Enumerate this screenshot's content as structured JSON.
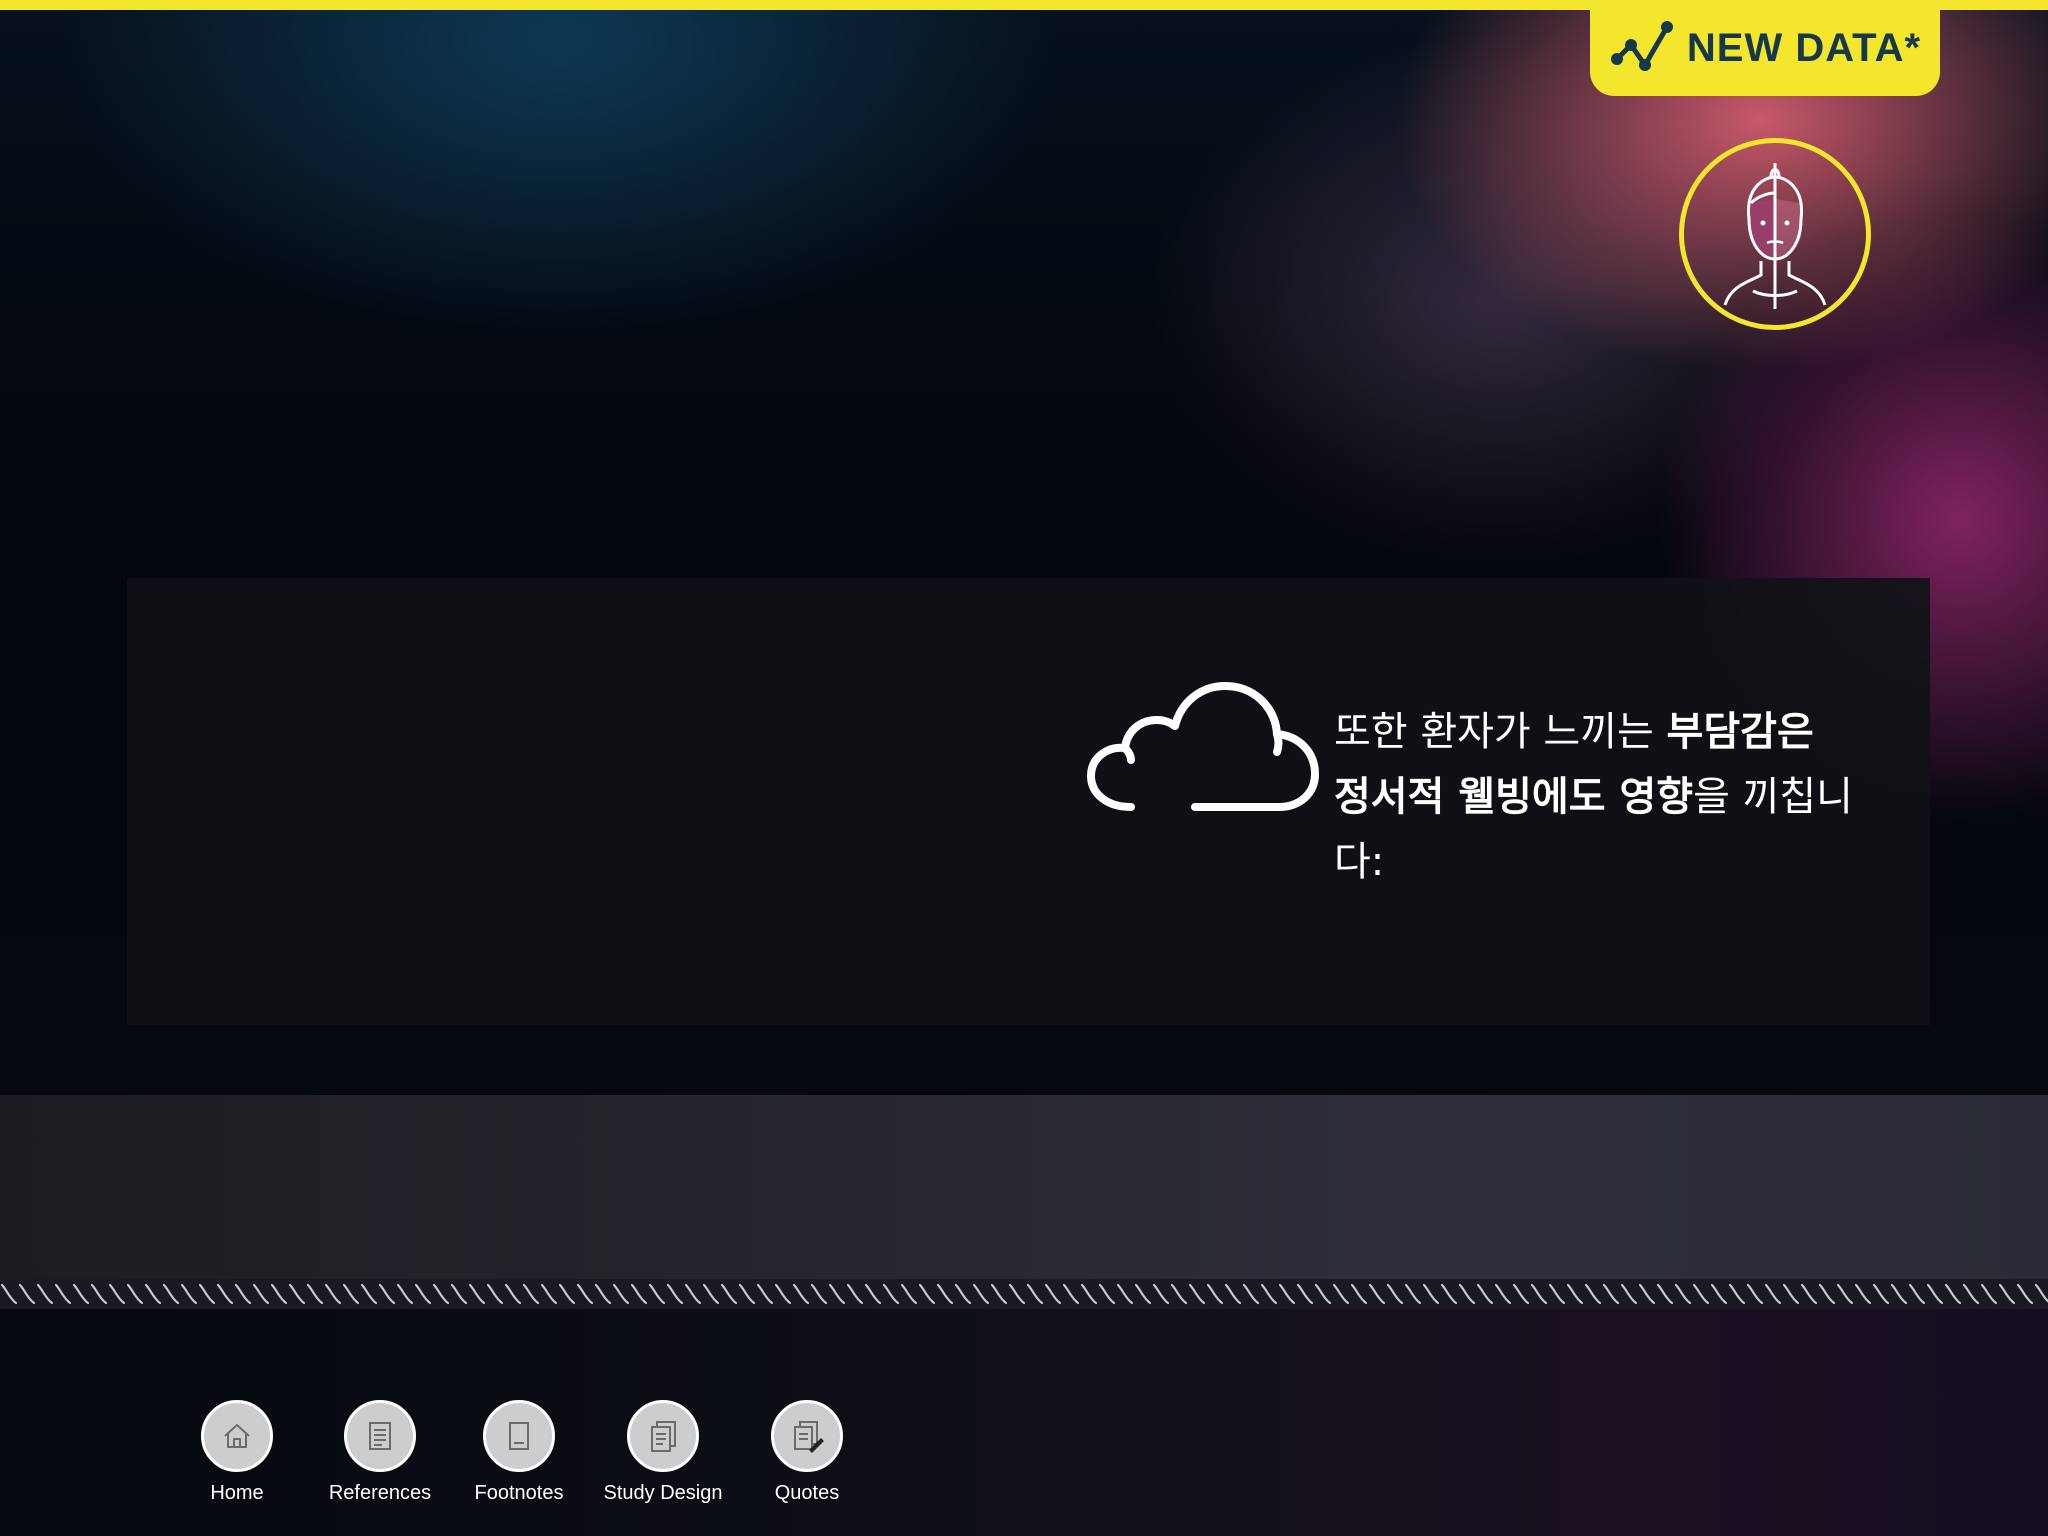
{
  "badge": {
    "label": "NEW DATA*",
    "icon": "line-chart-icon",
    "color": "#f4e52d",
    "text_color": "#15384b"
  },
  "avatar": {
    "icon": "split-face-icon",
    "ring_color": "#f4e52d"
  },
  "info": {
    "icon": "cloud-icon",
    "line1_regular": "또한 환자가 느끼는 ",
    "line1_bold": "부담감은",
    "line2_bold": "정서적 웰빙에도 영향",
    "line2_regular": "을 끼칩니다:"
  },
  "nav": {
    "items": [
      {
        "label": "Home",
        "icon": "home-icon"
      },
      {
        "label": "References",
        "icon": "references-icon"
      },
      {
        "label": "Footnotes",
        "icon": "footnotes-icon"
      },
      {
        "label": "Study Design",
        "icon": "study-design-icon"
      },
      {
        "label": "Quotes",
        "icon": "quotes-icon"
      }
    ]
  },
  "colors": {
    "accent": "#f4e52d",
    "background": "#070b14"
  }
}
